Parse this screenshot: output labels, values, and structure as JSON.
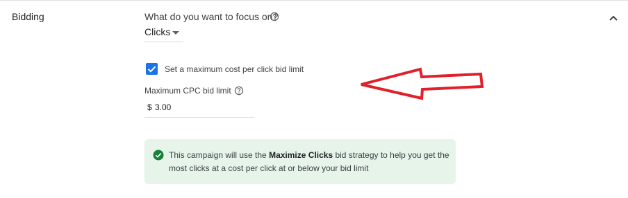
{
  "section": {
    "title": "Bidding",
    "collapse_icon": "chevron-up-icon"
  },
  "focus": {
    "question": "What do you want to focus on?",
    "selected": "Clicks"
  },
  "max_cpc_toggle": {
    "checked": true,
    "label": "Set a maximum cost per click bid limit"
  },
  "max_cpc": {
    "label": "Maximum CPC bid limit",
    "currency": "$",
    "value": "3.00"
  },
  "info": {
    "text_before": "This campaign will use the ",
    "strategy": "Maximize Clicks",
    "text_after": " bid strategy to help you get the most clicks at a cost per click at or below your bid limit"
  },
  "colors": {
    "accent": "#1a73e8",
    "success": "#188038",
    "info_bg": "#e6f4ea",
    "annotation_arrow": "#e0202a"
  }
}
